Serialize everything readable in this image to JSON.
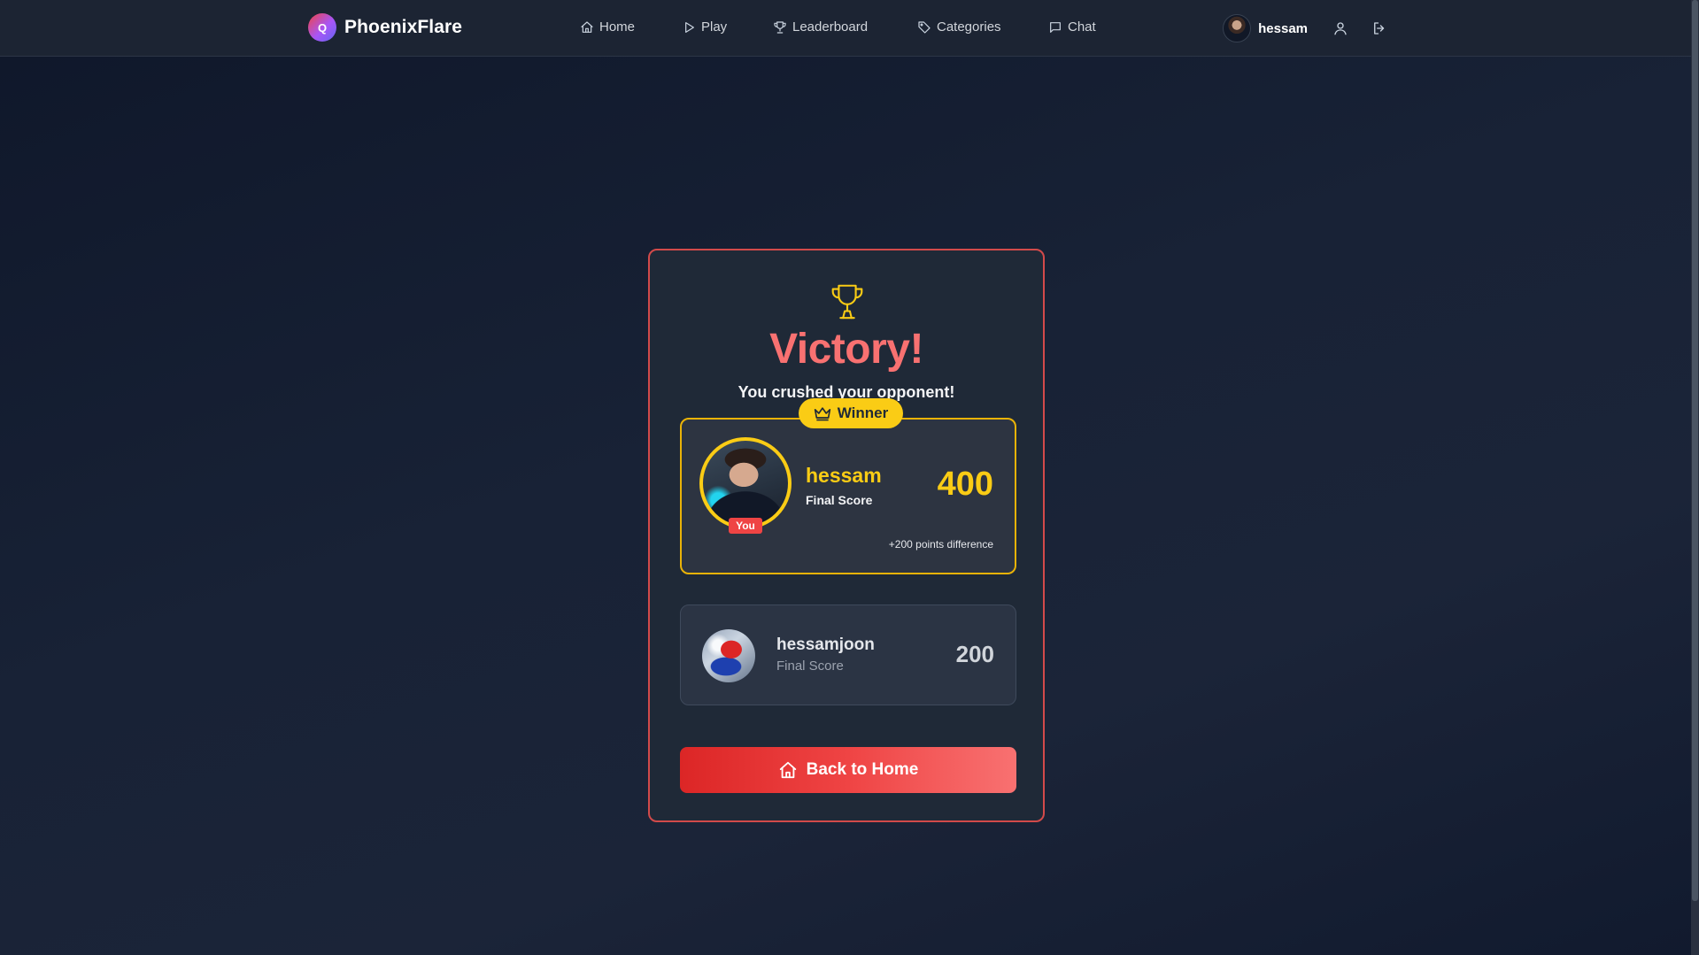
{
  "app": {
    "brand_initial": "Q",
    "brand_name": "PhoenixFlare"
  },
  "nav": {
    "items": [
      {
        "label": "Home",
        "icon": "home-icon"
      },
      {
        "label": "Play",
        "icon": "play-icon"
      },
      {
        "label": "Leaderboard",
        "icon": "trophy-icon"
      },
      {
        "label": "Categories",
        "icon": "tag-icon"
      },
      {
        "label": "Chat",
        "icon": "chat-icon"
      }
    ]
  },
  "user": {
    "name": "hessam",
    "icons": [
      "user-icon",
      "logout-icon"
    ]
  },
  "result": {
    "title": "Victory!",
    "subtitle": "You crushed your opponent!",
    "winner_badge": "Winner",
    "winner": {
      "name": "hessam",
      "label": "Final Score",
      "score": "400",
      "you_tag": "You",
      "difference": "+200 points difference"
    },
    "opponent": {
      "name": "hessamjoon",
      "label": "Final Score",
      "score": "200"
    },
    "back_button": "Back to Home"
  },
  "colors": {
    "accent_red": "#ef4444",
    "winner_gold": "#facc15",
    "card_bg": "#1f2937",
    "page_bg": "#111a2e"
  }
}
